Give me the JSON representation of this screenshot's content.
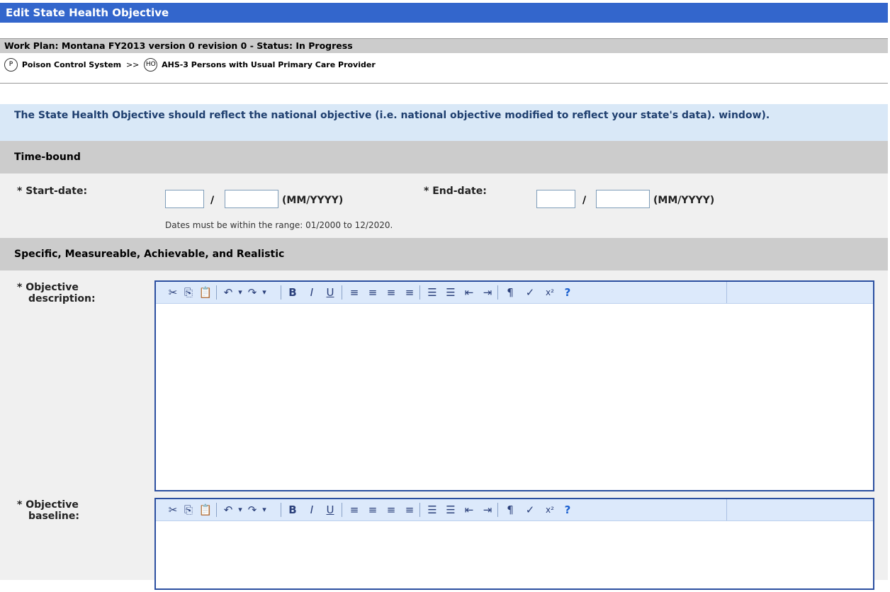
{
  "page": {
    "title": "Edit State Health Objective",
    "workplan": "Work Plan: Montana FY2013 version 0 revision 0 - Status: In Progress",
    "crumb": {
      "p_badge": "P",
      "p_label": "Poison Control System",
      "sep": ">>",
      "ho_badge": "HO",
      "ho_label": "AHS-3 Persons with Usual Primary Care Provider"
    },
    "notice": "The State Health Objective should reflect the national objective (i.e. national objective modified to reflect your state's data). window)."
  },
  "timebound": {
    "header": "Time-bound",
    "start_label": "* Start-date:",
    "end_label": "* End-date:",
    "slash": "/",
    "format": "(MM/YYYY)",
    "start_month": "",
    "start_year": "",
    "end_month": "",
    "end_year": "",
    "hint": "Dates must be within the range: 01/2000 to 12/2020."
  },
  "smart": {
    "header": "Specific, Measureable, Achievable, and Realistic",
    "desc_label_1": "* Objective",
    "desc_label_2": "description:",
    "base_label_1": "* Objective",
    "base_label_2": "baseline:"
  },
  "toolbar": {
    "icons": [
      "cut-icon",
      "copy-icon",
      "paste-icon",
      "undo-icon",
      "undo-dropdown-icon",
      "redo-icon",
      "redo-dropdown-icon",
      "bold-icon",
      "italic-icon",
      "underline-icon",
      "align-left-icon",
      "align-center-icon",
      "align-right-icon",
      "justify-icon",
      "ordered-list-icon",
      "unordered-list-icon",
      "outdent-icon",
      "indent-icon",
      "paragraph-icon",
      "spellcheck-icon",
      "superscript-icon",
      "help-icon"
    ],
    "glyphs": [
      "✂",
      "⎘",
      "📋",
      "↶",
      "▾",
      "↷",
      "▾",
      "B",
      "I",
      "U",
      "≡",
      "≡",
      "≡",
      "≡",
      "☰",
      "☰",
      "⇤",
      "⇥",
      "¶",
      "✓",
      "x²",
      "?"
    ]
  },
  "colors": {
    "title_bg": "#3366cc",
    "notice_bg": "#d9e8f7",
    "section_bg": "#cccccc",
    "editor_border": "#2b4fa0",
    "toolbar_bg": "#dce9fb"
  }
}
